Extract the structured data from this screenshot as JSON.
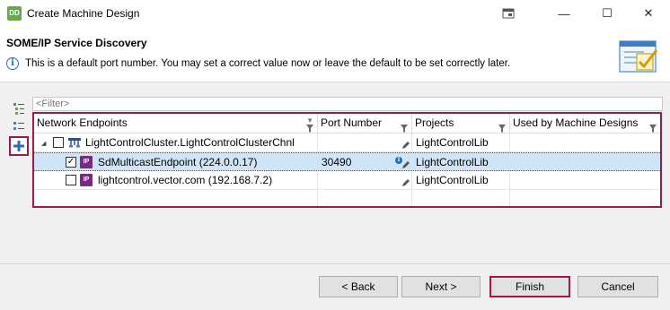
{
  "window": {
    "app_icon_text": "DD",
    "title": "Create Machine Design",
    "controls": {
      "restore_glyph": "▭",
      "minimize_glyph": "—",
      "maximize_glyph": "☐",
      "close_glyph": "✕"
    }
  },
  "header": {
    "title": "SOME/IP Service Discovery",
    "info_glyph": "i",
    "message": "This is a default port number. You may set a correct value now or leave the default to be set correctly later."
  },
  "filter": {
    "placeholder": "<Filter>"
  },
  "table": {
    "columns": [
      "Network Endpoints",
      "Port Number",
      "Projects",
      "Used by Machine Designs"
    ],
    "rows": [
      {
        "expander": "◢",
        "checked": false,
        "icon": "network-cluster-icon",
        "endpoint": "LightControlCluster.LightControlClusterChnl",
        "port": "",
        "project": "LightControlLib",
        "used_by": ""
      },
      {
        "checked": true,
        "check_glyph": "✓",
        "icon_text": "IP",
        "endpoint": "SdMulticastEndpoint (224.0.0.17)",
        "port": "30490",
        "project": "LightControlLib",
        "used_by": "",
        "info_glyph": "i"
      },
      {
        "checked": false,
        "icon_text": "IP",
        "endpoint": "lightcontrol.vector.com (192.168.7.2)",
        "port": "",
        "project": "LightControlLib",
        "used_by": ""
      }
    ]
  },
  "buttons": {
    "back": "< Back",
    "next": "Next >",
    "finish": "Finish",
    "cancel": "Cancel"
  },
  "colors": {
    "highlight_border": "#a4173f",
    "selected_row": "#cfe4f7",
    "ip_icon": "#7a2a7f",
    "accent_blue": "#2a6fb5"
  }
}
